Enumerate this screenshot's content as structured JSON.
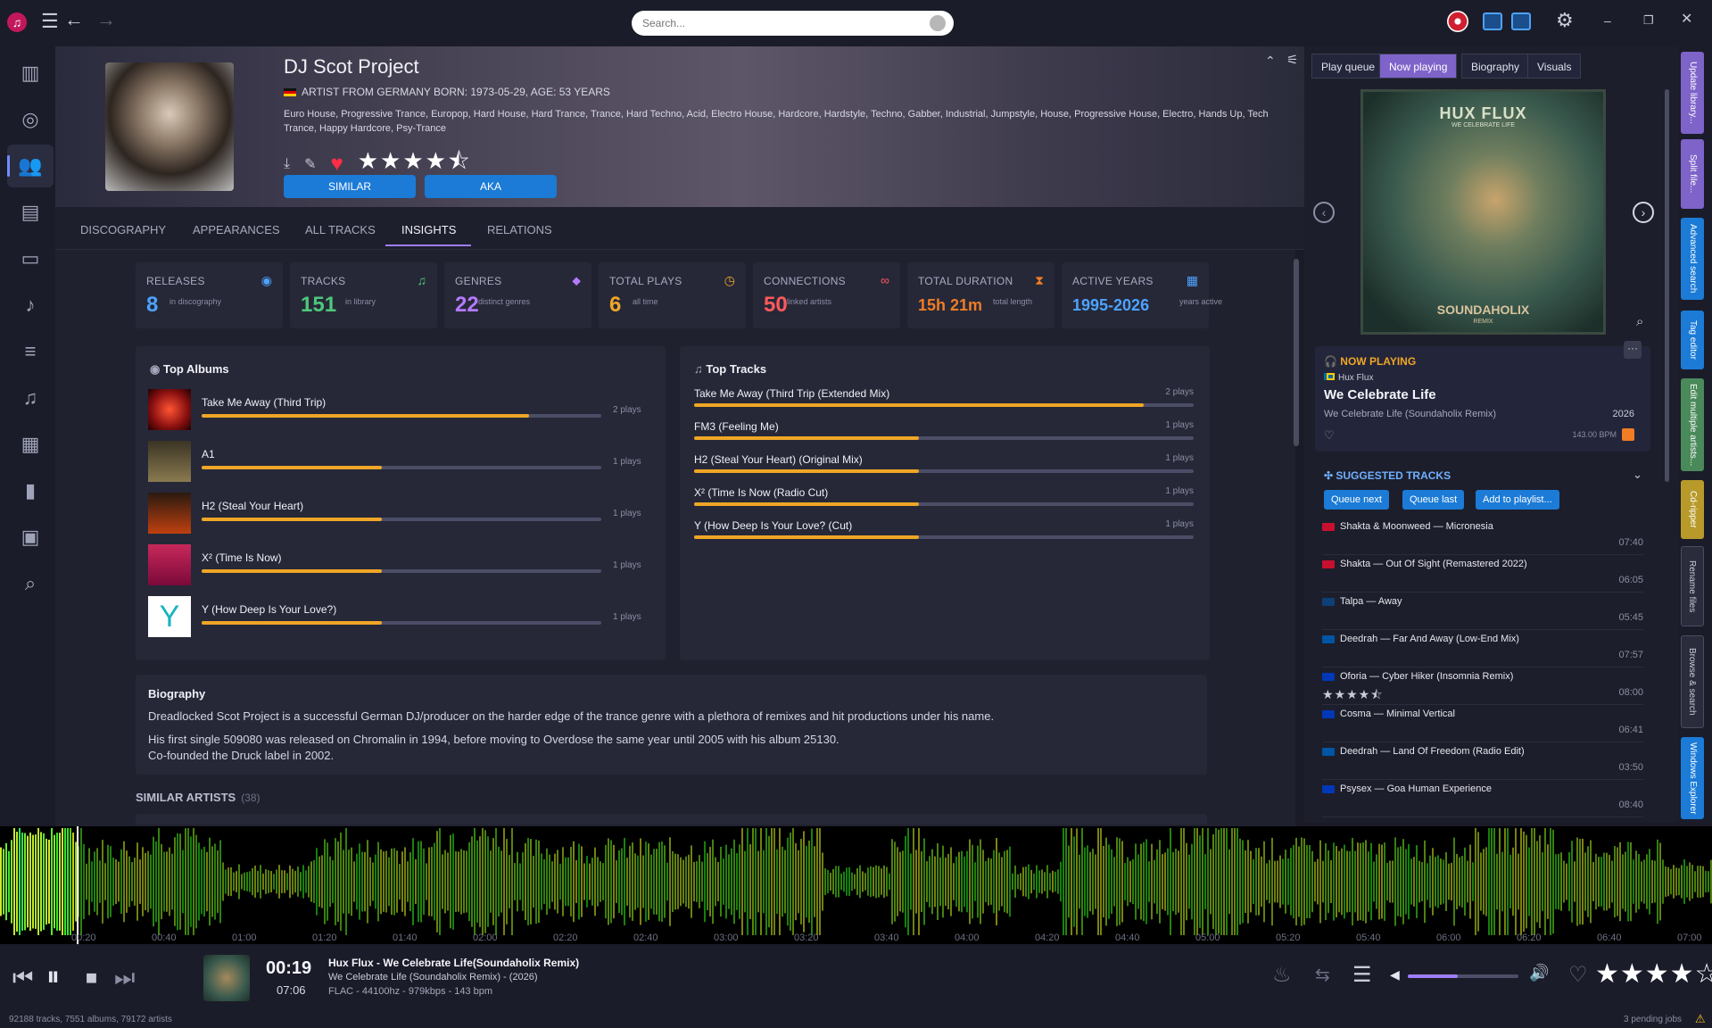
{
  "topbar": {
    "search_placeholder": "Search..."
  },
  "artist": {
    "name": "DJ Scot Project",
    "meta": "ARTIST FROM GERMANY  BORN: 1973-05-29, AGE: 53 YEARS",
    "genres": "Euro House, Progressive Trance, Europop, Hard House, Hard Trance, Trance, Hard Techno, Acid, Electro House, Hardcore, Hardstyle, Techno, Gabber, Industrial, Jumpstyle, House, Progressive House, Electro, Hands Up, Tech Trance, Happy Hardcore, Psy-Trance",
    "rating": 4.5,
    "similar_label": "SIMILAR",
    "aka_label": "AKA"
  },
  "tabs": [
    "DISCOGRAPHY",
    "APPEARANCES",
    "ALL TRACKS",
    "INSIGHTS",
    "RELATIONS"
  ],
  "stats": [
    {
      "label": "RELEASES",
      "value": "8",
      "sub": "in discography",
      "color": "#4da3ff",
      "icon": "disc-icon"
    },
    {
      "label": "TRACKS",
      "value": "151",
      "sub": "in library",
      "color": "#4ec77a",
      "icon": "music-note-icon"
    },
    {
      "label": "GENRES",
      "value": "22",
      "sub": "distinct genres",
      "color": "#b57aff",
      "icon": "tag-icon"
    },
    {
      "label": "TOTAL PLAYS",
      "value": "6",
      "sub": "all time",
      "color": "#f0a626",
      "icon": "clock-icon"
    },
    {
      "label": "CONNECTIONS",
      "value": "50",
      "sub": "linked artists",
      "color": "#ff5a5a",
      "icon": "link-icon"
    },
    {
      "label": "TOTAL DURATION",
      "value": "15h 21m",
      "sub": "total length",
      "color": "#f07c24",
      "icon": "hourglass-icon"
    },
    {
      "label": "ACTIVE YEARS",
      "value": "1995-2026",
      "sub": "years active",
      "color": "#4da3ff",
      "icon": "calendar-icon"
    }
  ],
  "top_albums": {
    "title": "Top Albums",
    "items": [
      {
        "name": "Take Me Away (Third Trip)",
        "plays": "2 plays",
        "fill": 0.82
      },
      {
        "name": "A1",
        "plays": "1 plays",
        "fill": 0.45
      },
      {
        "name": "H2 (Steal Your Heart)",
        "plays": "1 plays",
        "fill": 0.45
      },
      {
        "name": "X² (Time Is Now)",
        "plays": "1 plays",
        "fill": 0.45
      },
      {
        "name": "Y (How Deep Is Your Love?)",
        "plays": "1 plays",
        "fill": 0.45
      }
    ]
  },
  "top_tracks": {
    "title": "Top Tracks",
    "items": [
      {
        "name": "Take Me Away (Third Trip (Extended Mix)",
        "plays": "2 plays",
        "fill": 0.9
      },
      {
        "name": "FM3 (Feeling Me)",
        "plays": "1 plays",
        "fill": 0.45
      },
      {
        "name": "H2 (Steal Your Heart) (Original Mix)",
        "plays": "1 plays",
        "fill": 0.45
      },
      {
        "name": "X² (Time Is Now (Radio Cut)",
        "plays": "1 plays",
        "fill": 0.45
      },
      {
        "name": "Y (How Deep Is Your Love? (Cut)",
        "plays": "1 plays",
        "fill": 0.45
      }
    ]
  },
  "biography": {
    "title": "Biography",
    "p1": "Dreadlocked Scot Project is a successful German DJ/producer on the harder edge of the trance genre with a plethora of remixes and hit productions under his name.",
    "p2": "His first single 509080 was released on Chromalin in 1994, before moving to Overdose the same year until 2005 with his album 25130.",
    "p3": "Co-founded the Druck label in 2002."
  },
  "similar": {
    "title": "SIMILAR ARTISTS",
    "count": "(38)"
  },
  "right_tabs": [
    "Play queue",
    "Now playing",
    "Biography",
    "Visuals"
  ],
  "cover": {
    "title": "HUX FLUX",
    "sub": "WE CELEBRATE LIFE",
    "brand": "SOUNDAHOLIX",
    "remix": "REMIX"
  },
  "now_playing": {
    "label": "NOW PLAYING",
    "artist": "Hux Flux",
    "title": "We Celebrate Life",
    "album": "We Celebrate Life (Soundaholix Remix)",
    "year": "2026",
    "bpm": "143.00 BPM"
  },
  "suggested": {
    "label": "SUGGESTED TRACKS",
    "buttons": [
      "Queue next",
      "Queue last",
      "Add to playlist..."
    ],
    "items": [
      {
        "text": "Shakta & Moonweed — Micronesia",
        "dur": "07:40",
        "flag": "#c8102e"
      },
      {
        "text": "Shakta — Out Of Sight (Remastered 2022)",
        "dur": "06:05",
        "flag": "#c8102e"
      },
      {
        "text": "Talpa — Away",
        "dur": "05:45",
        "flag": "#0c4076"
      },
      {
        "text": "Deedrah — Far And Away (Low-End Mix)",
        "dur": "07:57",
        "flag": "#0055a4"
      },
      {
        "text": "Oforia — Cyber Hiker (Insomnia Remix)",
        "dur": "08:00",
        "flag": "#0038b8",
        "rating": 4.5
      },
      {
        "text": "Cosma — Minimal Vertical",
        "dur": "06:41",
        "flag": "#0038b8"
      },
      {
        "text": "Deedrah — Land Of Freedom (Radio Edit)",
        "dur": "03:50",
        "flag": "#0055a4"
      },
      {
        "text": "Psysex — Goa Human Experience",
        "dur": "08:40",
        "flag": "#0038b8"
      }
    ]
  },
  "vtabs": [
    {
      "label": "Update library...",
      "color": "#7e63c9"
    },
    {
      "label": "Split file...",
      "color": "#7e63c9"
    },
    {
      "label": "Advanced search",
      "color": "#1b7bd6"
    },
    {
      "label": "Tag editor",
      "color": "#1b7bd6"
    },
    {
      "label": "Edit multiple artists...",
      "color": "#4a8a5a"
    },
    {
      "label": "Cd-ripper",
      "color": "#b89a2a"
    },
    {
      "label": "Rename files",
      "color": "#2a2c3c"
    },
    {
      "label": "Browse & search",
      "color": "#2a2c3c"
    },
    {
      "label": "Windows Explorer",
      "color": "#1b7bd6"
    }
  ],
  "waveform": {
    "ticks": [
      "00:20",
      "00:40",
      "01:00",
      "01:20",
      "01:40",
      "02:00",
      "02:20",
      "02:40",
      "03:00",
      "03:20",
      "03:40",
      "04:00",
      "04:20",
      "04:40",
      "05:00",
      "05:20",
      "05:40",
      "06:00",
      "06:20",
      "06:40",
      "07:00"
    ],
    "progress": 0.045
  },
  "player": {
    "elapsed": "00:19",
    "total": "07:06",
    "line1": "Hux Flux - We Celebrate Life(Soundaholix Remix)",
    "line2": "We Celebrate Life (Soundaholix Remix) - (2026)",
    "line3": "FLAC - 44100hz - 979kbps - 143 bpm",
    "volume": 0.45,
    "rating": 4
  },
  "status": {
    "left": "92188 tracks, 7551 albums, 79172 artists",
    "right": "3 pending jobs"
  }
}
